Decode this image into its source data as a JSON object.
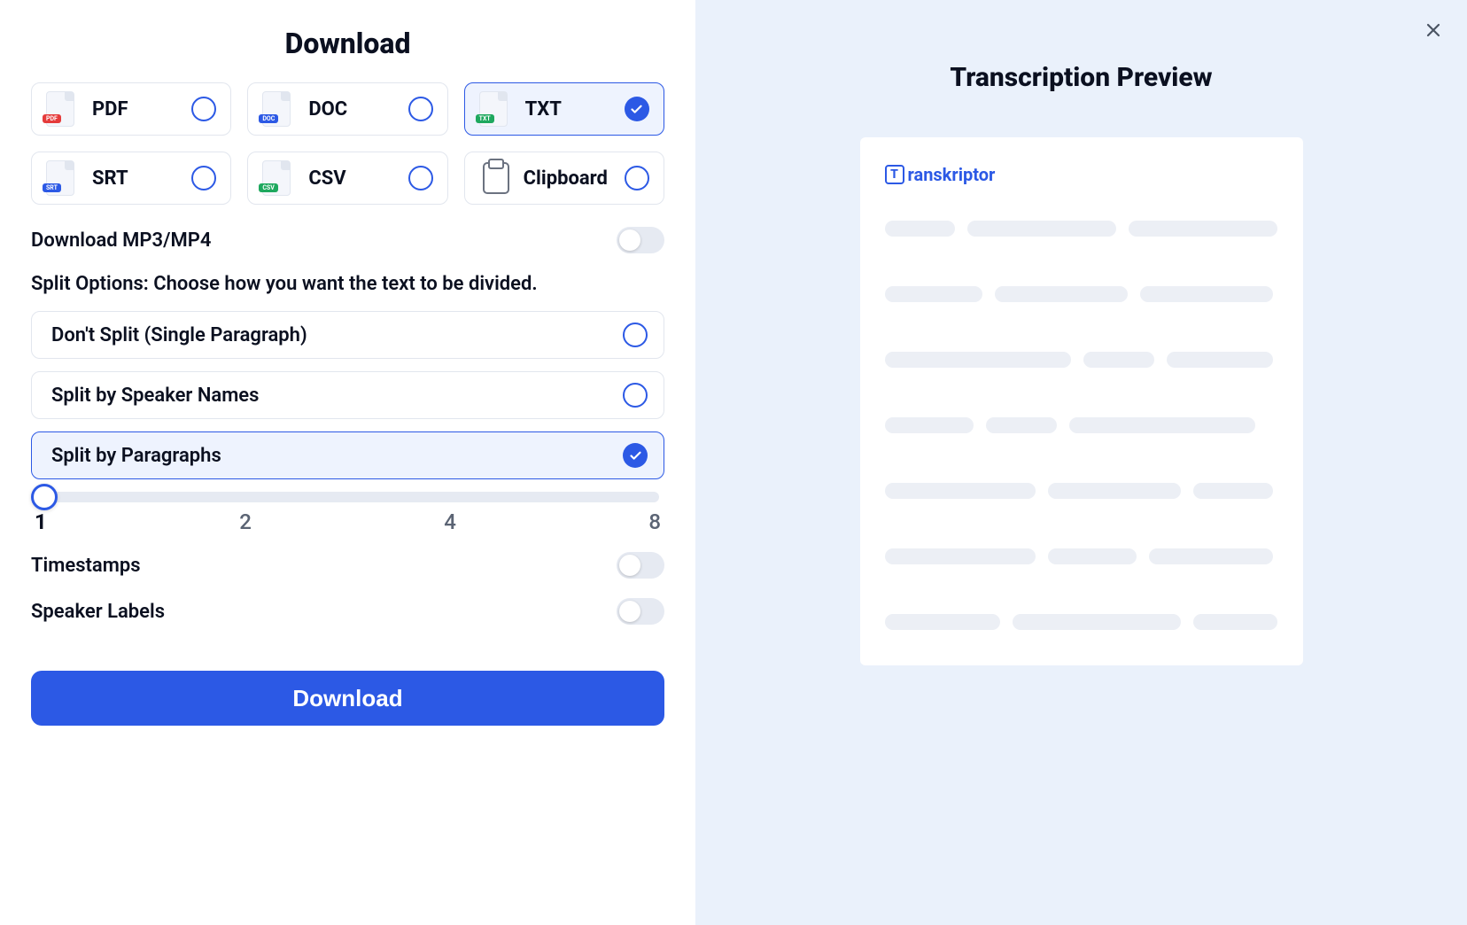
{
  "download_title": "Download",
  "formats": [
    {
      "label": "PDF",
      "badge": "PDF",
      "badgeClass": "badge-pdf",
      "selected": false
    },
    {
      "label": "DOC",
      "badge": "DOC",
      "badgeClass": "badge-doc",
      "selected": false
    },
    {
      "label": "TXT",
      "badge": "TXT",
      "badgeClass": "badge-txt",
      "selected": true
    },
    {
      "label": "SRT",
      "badge": "SRT",
      "badgeClass": "badge-srt",
      "selected": false
    },
    {
      "label": "CSV",
      "badge": "CSV",
      "badgeClass": "badge-csv",
      "selected": false
    },
    {
      "label": "Clipboard",
      "isClipboard": true,
      "selected": false
    }
  ],
  "download_media_label": "Download MP3/MP4",
  "download_media_on": false,
  "split_section_label": "Split Options: Choose how you want the text to be divided.",
  "split_options": [
    {
      "label": "Don't Split (Single Paragraph)",
      "selected": false
    },
    {
      "label": "Split by Speaker Names",
      "selected": false
    },
    {
      "label": "Split by Paragraphs",
      "selected": true
    }
  ],
  "slider": {
    "value": 1,
    "marks": [
      "1",
      "2",
      "4",
      "8"
    ]
  },
  "timestamps_label": "Timestamps",
  "timestamps_on": false,
  "speaker_labels_label": "Speaker Labels",
  "speaker_labels_on": false,
  "download_button": "Download",
  "preview_title": "Transcription Preview",
  "brand_name": "ranskriptor",
  "brand_letter": "T"
}
